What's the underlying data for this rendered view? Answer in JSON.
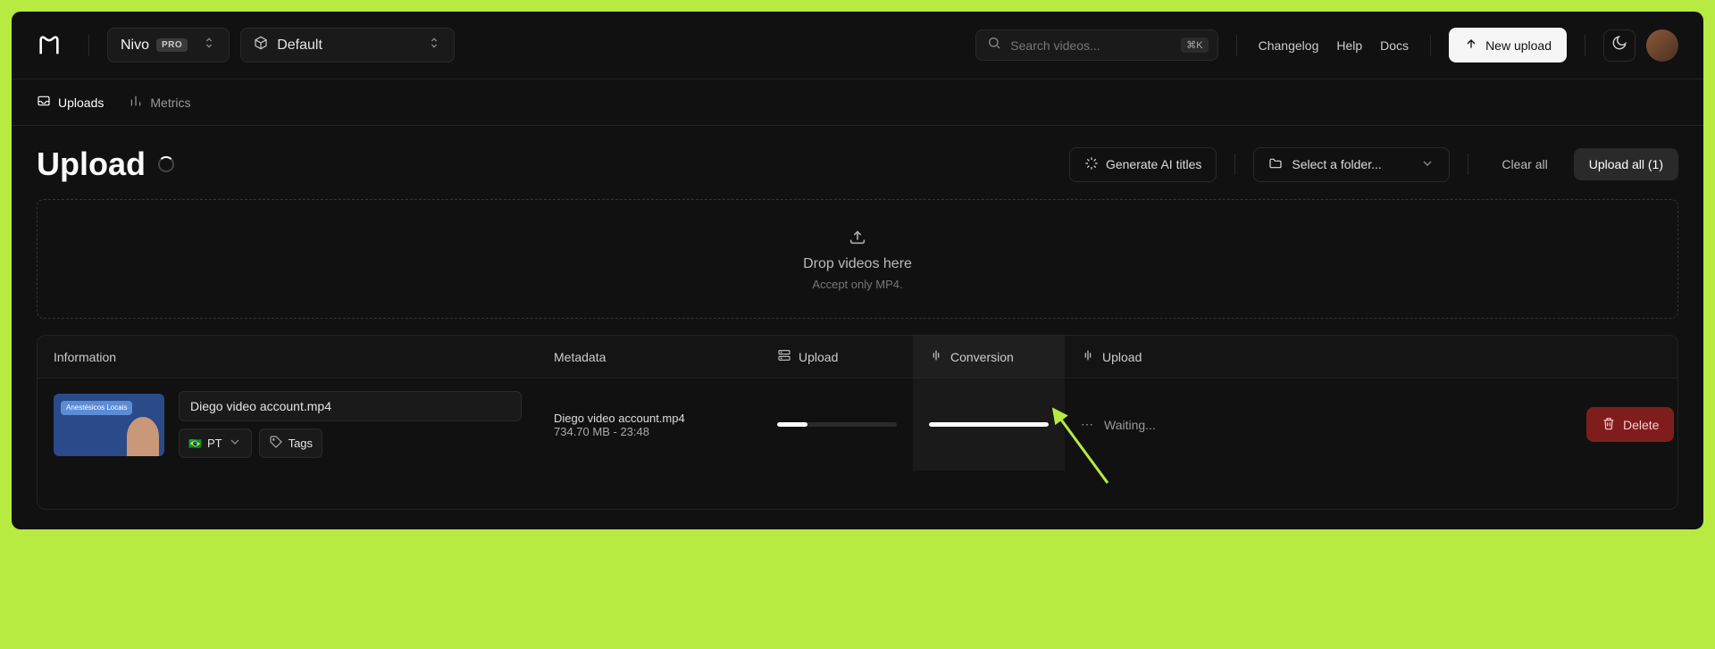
{
  "header": {
    "workspace": {
      "name": "Nivo",
      "badge": "PRO"
    },
    "project": "Default",
    "search": {
      "placeholder": "Search videos...",
      "shortcut": "⌘K"
    },
    "links": {
      "changelog": "Changelog",
      "help": "Help",
      "docs": "Docs"
    },
    "new_upload": "New upload"
  },
  "subnav": {
    "uploads": "Uploads",
    "metrics": "Metrics"
  },
  "page": {
    "title": "Upload",
    "generate_ai": "Generate AI titles",
    "select_folder": "Select a folder...",
    "clear_all": "Clear all",
    "upload_all": "Upload all (1)"
  },
  "dropzone": {
    "title": "Drop videos here",
    "subtitle": "Accept only MP4."
  },
  "columns": {
    "information": "Information",
    "metadata": "Metadata",
    "upload": "Upload",
    "conversion": "Conversion",
    "upload2": "Upload"
  },
  "row": {
    "filename_input": "Diego video account.mp4",
    "lang": "PT",
    "tags_label": "Tags",
    "thumbnail_text": "Anestésicos Locais",
    "metadata": {
      "filename": "Diego video account.mp4",
      "size": "734.70 MB",
      "duration": "23:48"
    },
    "upload_progress_pct": 25,
    "conversion_progress_pct": 100,
    "upload2_status": "Waiting...",
    "delete": "Delete"
  }
}
